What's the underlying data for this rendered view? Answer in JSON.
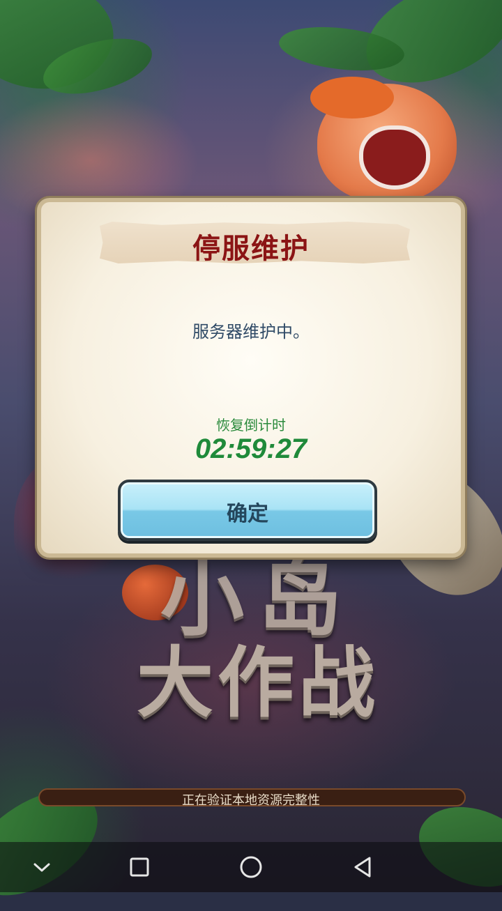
{
  "dialog": {
    "title": "停服维护",
    "message": "服务器维护中。",
    "countdown_label": "恢复倒计时",
    "countdown_value": "02:59:27",
    "confirm_label": "确定"
  },
  "game_logo": {
    "line1": "小岛",
    "line2": "大作战"
  },
  "loading": {
    "status_text": "正在验证本地资源完整性",
    "progress": 0.0
  },
  "navbar": {
    "icons": [
      "chevron-down-icon",
      "square-recents-icon",
      "circle-home-icon",
      "triangle-back-icon"
    ]
  },
  "colors": {
    "title_red": "#8b1414",
    "countdown_green": "#1f8a3a",
    "button_blue": "#a9e3f5"
  }
}
